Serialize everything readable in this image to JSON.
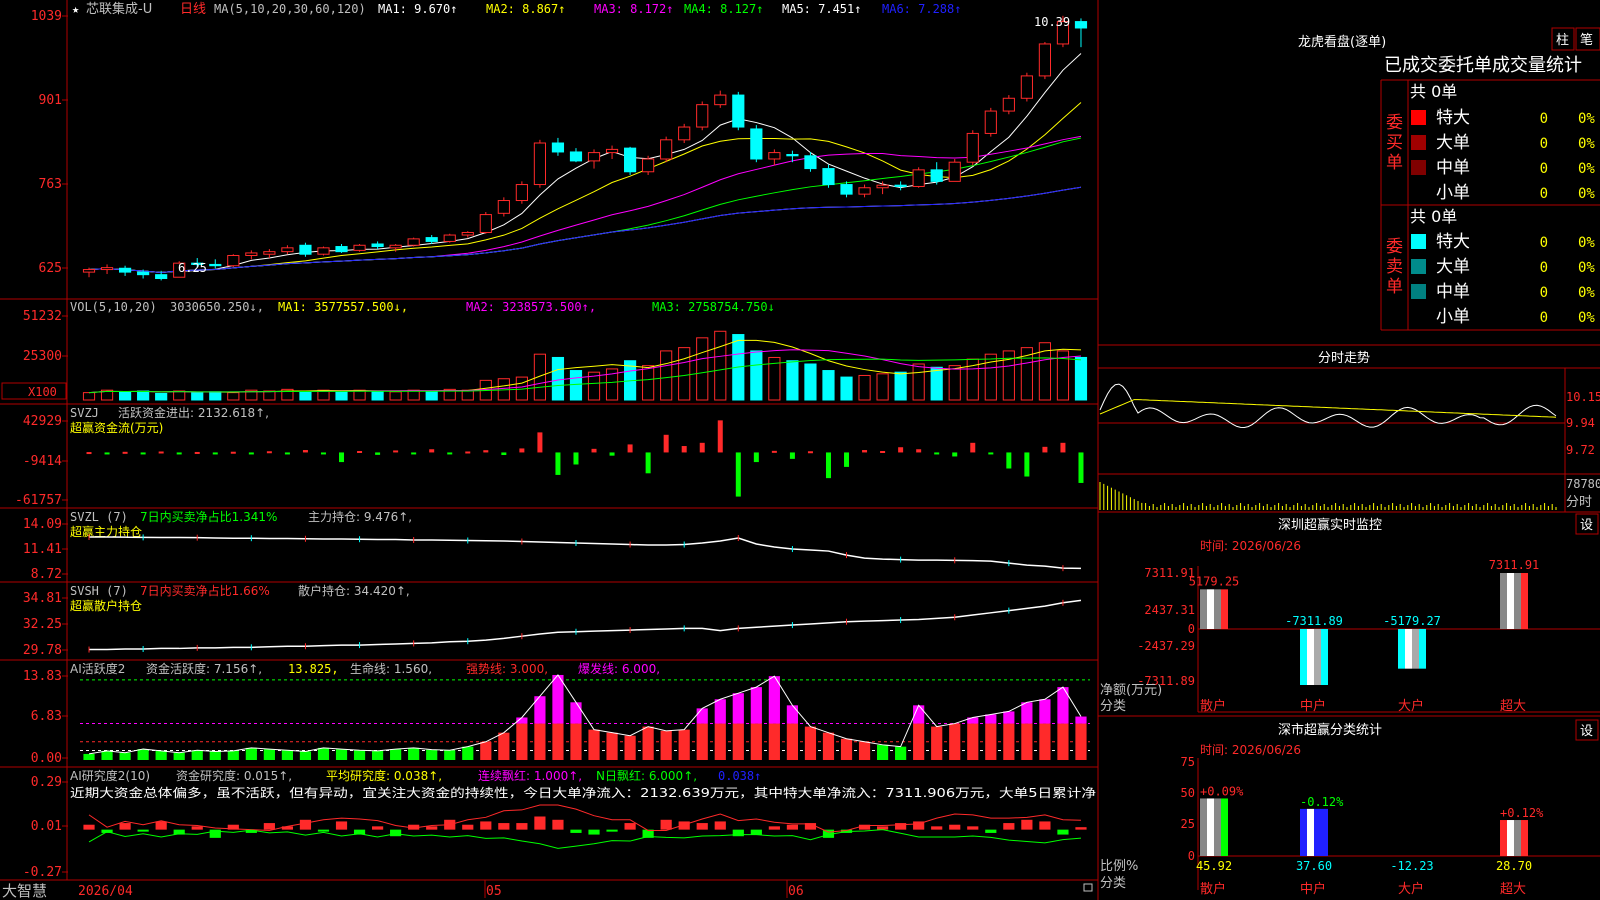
{
  "colors": {
    "up": "#ff2a2a",
    "down": "#00ffff",
    "axis": "#b00000",
    "gray": "#c0c0c0",
    "ma1": "#ffffff",
    "ma2": "#ffff00",
    "ma3": "#ff00ff",
    "ma4": "#00ff00",
    "ma5": "#ffffff",
    "ma6": "#2020ff",
    "yellow": "#ffff00",
    "green": "#00ff00",
    "magenta": "#ff00ff",
    "red": "#ff2a2a",
    "cyan": "#00ffff"
  },
  "app": {
    "name": "大智慧"
  },
  "kline": {
    "star": "★",
    "title": "芯联集成-U",
    "period": "日线",
    "ma_params": "MA(5,10,20,30,60,120)",
    "ma_items": [
      {
        "label": "MA1: 9.670↑",
        "color": "#ffffff"
      },
      {
        "label": "MA2: 8.867↑",
        "color": "#ffff00"
      },
      {
        "label": "MA3: 8.172↑",
        "color": "#ff00ff"
      },
      {
        "label": "MA4: 8.127↑",
        "color": "#00ff00"
      },
      {
        "label": "MA5: 7.451↑",
        "color": "#ffffff"
      },
      {
        "label": "MA6: 7.288↑",
        "color": "#2020ff"
      }
    ],
    "y_ticks": [
      "1039",
      "901",
      "763",
      "625"
    ],
    "high_label": "10.39",
    "low_label": "6.25"
  },
  "vol": {
    "header": "VOL(5,10,20)",
    "value": "3030650.250↓,",
    "items": [
      {
        "label": "MA1: 3577557.500↓,",
        "color": "#ffff00"
      },
      {
        "label": "MA2: 3238573.500↑,",
        "color": "#ff00ff"
      },
      {
        "label": "MA3: 2758754.750↓",
        "color": "#00ff00"
      }
    ],
    "y_ticks": [
      "51232",
      "25300"
    ],
    "unit": "X100"
  },
  "svzj": {
    "header": "SVZJ",
    "item1": "活跃资金进出: 2132.618↑,",
    "sub": "超赢资金流(万元)",
    "y_ticks": [
      "42929",
      "-9414",
      "-61757"
    ]
  },
  "svzl": {
    "header": "SVZL (7)",
    "item1": "7日内买卖净占比1.341%",
    "item2": "主力持仓: 9.476↑,",
    "sub": "超赢主力持仓",
    "y_ticks": [
      "14.09",
      "11.41",
      "8.72"
    ]
  },
  "svsh": {
    "header": "SVSH (7)",
    "item1": "7日内买卖净占比1.66%",
    "item2": "散户持仓: 34.420↑,",
    "sub": "超赢散户持仓",
    "y_ticks": [
      "34.81",
      "32.25",
      "29.78"
    ]
  },
  "ai1": {
    "header": "AI活跃度2",
    "item1": "资金活跃度: 7.156↑,",
    "item2": "13.825,",
    "item3": "生命线: 1.560,",
    "item4": "强势线: 3.000,",
    "item5": "爆发线: 6.000,",
    "y_ticks": [
      "13.83",
      "6.83",
      "0.00"
    ]
  },
  "ai2": {
    "header": "AI研究度2(10)",
    "item1": "资金研究度: 0.015↑,",
    "item2": "平均研究度: 0.038↑,",
    "item3": "连续飘红: 1.000↑,",
    "item4": "N日飘红: 6.000↑,",
    "item5": "0.038↑",
    "comment": "近期大资金总体偏多，虽不活跃，但有异动，宜关注大资金的持续性，今日大单净流入：2132.639万元，其中特大单净流入：7311.906万元，大单5日累计净",
    "y_ticks": [
      "0.29",
      "0.01",
      "-0.27"
    ]
  },
  "x_axis": [
    "2026/04",
    "05",
    "06"
  ],
  "lhb": {
    "title": "龙虎看盘(逐单)",
    "btn1": "柱",
    "btn2": "笔",
    "tabs": "已成交委托单成交量统计",
    "buy_label": "委买单",
    "sell_label": "委卖单",
    "buy_total": "共 0单",
    "sell_total": "共 0单",
    "buy_rows": [
      {
        "name": "特大",
        "count": "0",
        "pct": "0%",
        "color": "#ff0000"
      },
      {
        "name": "大单",
        "count": "0",
        "pct": "0%",
        "color": "#a00000"
      },
      {
        "name": "中单",
        "count": "0",
        "pct": "0%",
        "color": "#800000"
      },
      {
        "name": "小单",
        "count": "0",
        "pct": "0%",
        "color": ""
      }
    ],
    "sell_rows": [
      {
        "name": "特大",
        "count": "0",
        "pct": "0%",
        "color": "#00ffff"
      },
      {
        "name": "大单",
        "count": "0",
        "pct": "0%",
        "color": "#008b8b"
      },
      {
        "name": "中单",
        "count": "0",
        "pct": "0%",
        "color": "#008080"
      },
      {
        "name": "小单",
        "count": "0",
        "pct": "0%",
        "color": ""
      }
    ]
  },
  "intraday": {
    "title": "分时走势",
    "y_ticks": [
      "10.15",
      "9.94",
      "9.72"
    ],
    "vol_label": "78780",
    "bottom_label": "分时"
  },
  "sz_monitor": {
    "title": "深圳超赢实时监控",
    "btn": "设",
    "time": "时间: 2026/06/26",
    "y_ticks": [
      "7311.91",
      "2437.31",
      "0",
      "-2437.29",
      "-7311.89"
    ],
    "ylabel": "净额(万元)",
    "xlabel": "分类",
    "categories": [
      "散户",
      "中户",
      "大户",
      "超大"
    ]
  },
  "sh_stats": {
    "title": "深市超赢分类统计",
    "btn": "设",
    "time": "时间: 2026/06/26",
    "y_ticks": [
      "75",
      "50",
      "25",
      "0"
    ],
    "ylabel": "比例%",
    "xlabel": "分类",
    "categories": [
      "散户",
      "中户",
      "大户",
      "超大"
    ]
  },
  "chart_data": [
    {
      "type": "candlestick",
      "name": "芯联集成-U 日线",
      "ylim": [
        6.1,
        10.45
      ],
      "ohlc": [
        [
          6.38,
          6.45,
          6.3,
          6.42
        ],
        [
          6.42,
          6.5,
          6.35,
          6.45
        ],
        [
          6.44,
          6.48,
          6.32,
          6.38
        ],
        [
          6.38,
          6.42,
          6.28,
          6.34
        ],
        [
          6.34,
          6.4,
          6.25,
          6.28
        ],
        [
          6.3,
          6.55,
          6.3,
          6.52
        ],
        [
          6.52,
          6.6,
          6.46,
          6.5
        ],
        [
          6.5,
          6.58,
          6.44,
          6.48
        ],
        [
          6.48,
          6.66,
          6.46,
          6.64
        ],
        [
          6.64,
          6.72,
          6.58,
          6.68
        ],
        [
          6.66,
          6.74,
          6.6,
          6.7
        ],
        [
          6.7,
          6.8,
          6.66,
          6.76
        ],
        [
          6.8,
          6.84,
          6.62,
          6.66
        ],
        [
          6.66,
          6.78,
          6.64,
          6.76
        ],
        [
          6.78,
          6.82,
          6.68,
          6.7
        ],
        [
          6.72,
          6.82,
          6.7,
          6.8
        ],
        [
          6.82,
          6.86,
          6.74,
          6.78
        ],
        [
          6.76,
          6.82,
          6.7,
          6.8
        ],
        [
          6.8,
          6.92,
          6.78,
          6.9
        ],
        [
          6.92,
          6.96,
          6.82,
          6.86
        ],
        [
          6.86,
          6.98,
          6.84,
          6.96
        ],
        [
          6.96,
          7.02,
          6.92,
          7.0
        ],
        [
          7.0,
          7.32,
          6.98,
          7.28
        ],
        [
          7.3,
          7.55,
          7.25,
          7.5
        ],
        [
          7.5,
          7.8,
          7.45,
          7.75
        ],
        [
          7.75,
          8.45,
          7.7,
          8.4
        ],
        [
          8.4,
          8.48,
          8.2,
          8.26
        ],
        [
          8.26,
          8.32,
          8.1,
          8.12
        ],
        [
          8.12,
          8.3,
          8.0,
          8.25
        ],
        [
          8.25,
          8.36,
          8.15,
          8.3
        ],
        [
          8.32,
          8.34,
          7.9,
          7.95
        ],
        [
          7.95,
          8.2,
          7.9,
          8.15
        ],
        [
          8.15,
          8.5,
          8.1,
          8.45
        ],
        [
          8.45,
          8.7,
          8.4,
          8.65
        ],
        [
          8.65,
          9.05,
          8.6,
          9.0
        ],
        [
          9.0,
          9.22,
          8.95,
          9.15
        ],
        [
          9.15,
          9.2,
          8.6,
          8.65
        ],
        [
          8.62,
          8.68,
          8.1,
          8.15
        ],
        [
          8.15,
          8.3,
          8.05,
          8.25
        ],
        [
          8.22,
          8.28,
          8.1,
          8.2
        ],
        [
          8.2,
          8.26,
          7.95,
          8.0
        ],
        [
          8.0,
          8.06,
          7.7,
          7.75
        ],
        [
          7.75,
          7.8,
          7.55,
          7.6
        ],
        [
          7.6,
          7.75,
          7.55,
          7.7
        ],
        [
          7.7,
          7.8,
          7.6,
          7.74
        ],
        [
          7.74,
          7.8,
          7.66,
          7.72
        ],
        [
          7.72,
          8.02,
          7.7,
          7.98
        ],
        [
          7.98,
          8.1,
          7.75,
          7.8
        ],
        [
          7.8,
          8.15,
          7.8,
          8.1
        ],
        [
          8.1,
          8.6,
          8.05,
          8.55
        ],
        [
          8.55,
          8.95,
          8.5,
          8.9
        ],
        [
          8.9,
          9.15,
          8.85,
          9.1
        ],
        [
          9.1,
          9.5,
          9.05,
          9.45
        ],
        [
          9.45,
          9.98,
          9.4,
          9.95
        ],
        [
          9.95,
          10.39,
          9.9,
          10.3
        ],
        [
          10.3,
          10.35,
          9.9,
          10.2
        ]
      ]
    },
    {
      "type": "bar",
      "name": "VOL",
      "ylim": [
        0,
        55000
      ],
      "values": [
        4500,
        6000,
        5000,
        5500,
        4000,
        5500,
        4500,
        5000,
        4500,
        6000,
        5500,
        6500,
        5000,
        6000,
        5500,
        6000,
        5500,
        5000,
        6000,
        5500,
        6500,
        6000,
        12000,
        13000,
        14000,
        28000,
        26000,
        18000,
        17000,
        19000,
        24000,
        21000,
        30000,
        32000,
        38000,
        42000,
        40000,
        30000,
        26000,
        24000,
        22000,
        18000,
        14000,
        15000,
        16000,
        17000,
        22000,
        20000,
        21000,
        25000,
        28000,
        30000,
        32000,
        35000,
        30000,
        26000
      ]
    },
    {
      "type": "bar",
      "name": "超赢资金流(万元)",
      "ylim": [
        -61757,
        42929
      ],
      "values": [
        500,
        -1500,
        800,
        -2000,
        1200,
        -1800,
        600,
        -2500,
        900,
        -1000,
        1500,
        -1200,
        3000,
        -2200,
        -12000,
        1800,
        -3000,
        2500,
        -1500,
        4000,
        -1800,
        1200,
        2800,
        -3200,
        5000,
        25000,
        -28000,
        -15000,
        4500,
        -4000,
        10000,
        -26000,
        22000,
        8000,
        12000,
        40000,
        -55000,
        -12000,
        2000,
        -8000,
        1500,
        -32000,
        -18000,
        3000,
        1800,
        6500,
        4000,
        -2500,
        -5000,
        12000,
        -2000,
        -20000,
        -30000,
        7000,
        12000,
        -38000
      ]
    },
    {
      "type": "line",
      "name": "主力持仓",
      "ylim": [
        8.72,
        14.09
      ],
      "values": [
        12.6,
        12.6,
        12.58,
        12.56,
        12.55,
        12.55,
        12.53,
        12.5,
        12.48,
        12.48,
        12.45,
        12.45,
        12.42,
        12.4,
        12.4,
        12.38,
        12.35,
        12.35,
        12.3,
        12.3,
        12.28,
        12.25,
        12.22,
        12.2,
        12.15,
        12.1,
        12.05,
        12.0,
        11.95,
        11.9,
        11.85,
        11.8,
        11.8,
        11.85,
        12.0,
        12.2,
        12.5,
        11.9,
        11.6,
        11.4,
        11.3,
        11.2,
        10.8,
        10.5,
        10.4,
        10.35,
        10.3,
        10.3,
        10.28,
        10.25,
        10.2,
        10.0,
        9.8,
        9.7,
        9.5,
        9.476
      ]
    },
    {
      "type": "line",
      "name": "散户持仓",
      "ylim": [
        29.78,
        34.81
      ],
      "values": [
        30.0,
        30.0,
        30.05,
        30.05,
        30.1,
        30.1,
        30.15,
        30.15,
        30.2,
        30.2,
        30.25,
        30.3,
        30.3,
        30.35,
        30.4,
        30.4,
        30.45,
        30.5,
        30.55,
        30.6,
        30.7,
        30.75,
        30.85,
        31.0,
        31.2,
        31.4,
        31.55,
        31.6,
        31.65,
        31.7,
        31.75,
        31.8,
        31.85,
        31.9,
        31.9,
        31.7,
        31.9,
        32.0,
        32.1,
        32.2,
        32.3,
        32.4,
        32.5,
        32.55,
        32.6,
        32.65,
        32.7,
        32.8,
        32.9,
        33.1,
        33.3,
        33.5,
        33.7,
        33.9,
        34.2,
        34.42
      ]
    },
    {
      "type": "bar",
      "name": "资金活跃度",
      "ylim": [
        0,
        13.83
      ],
      "values": [
        1.0,
        1.5,
        1.2,
        1.8,
        1.5,
        1.2,
        1.6,
        1.4,
        1.5,
        2.0,
        1.8,
        1.6,
        1.4,
        2.0,
        1.8,
        1.6,
        1.5,
        1.8,
        2.0,
        1.7,
        1.6,
        2.2,
        3.0,
        4.5,
        7.0,
        10.5,
        14.0,
        9.5,
        5.0,
        4.5,
        4.0,
        5.5,
        4.8,
        5.0,
        8.5,
        10.0,
        11.0,
        12.0,
        13.8,
        9.0,
        5.5,
        4.5,
        3.5,
        3.0,
        2.5,
        2.2,
        9.0,
        5.5,
        6.0,
        7.0,
        7.5,
        8.0,
        9.5,
        10.0,
        12.0,
        7.156
      ]
    },
    {
      "type": "bar",
      "name": "资金研究度",
      "ylim": [
        -0.27,
        0.29
      ],
      "values": [
        0.03,
        -0.02,
        0.04,
        -0.01,
        0.05,
        -0.03,
        0.02,
        -0.05,
        0.03,
        -0.02,
        0.04,
        0.02,
        0.06,
        -0.01,
        0.05,
        -0.03,
        0.02,
        -0.04,
        0.03,
        0.02,
        0.06,
        0.03,
        0.05,
        0.04,
        0.04,
        0.08,
        0.06,
        -0.02,
        -0.03,
        -0.01,
        0.04,
        -0.05,
        0.06,
        0.05,
        0.04,
        0.05,
        -0.04,
        -0.03,
        0.02,
        0.03,
        0.04,
        -0.05,
        -0.02,
        0.03,
        0.02,
        0.04,
        0.05,
        0.02,
        0.03,
        0.02,
        -0.02,
        0.04,
        0.06,
        0.05,
        -0.03,
        0.015
      ]
    }
  ]
}
